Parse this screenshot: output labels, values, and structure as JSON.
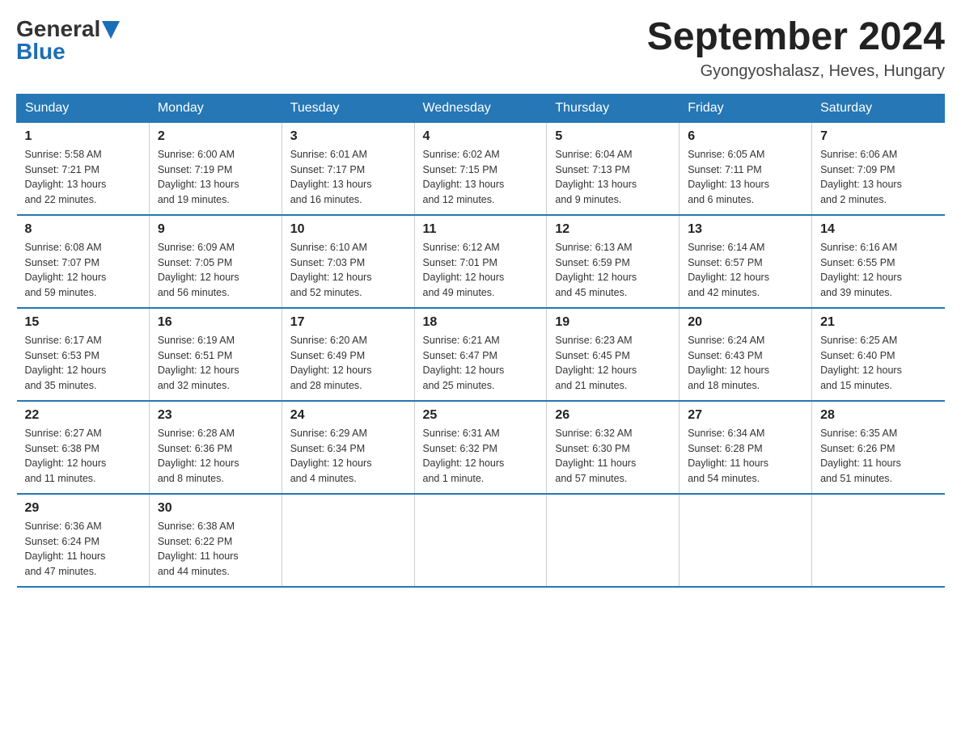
{
  "header": {
    "logo_general": "General",
    "logo_blue": "Blue",
    "title": "September 2024",
    "subtitle": "Gyongyoshalasz, Heves, Hungary"
  },
  "weekdays": [
    "Sunday",
    "Monday",
    "Tuesday",
    "Wednesday",
    "Thursday",
    "Friday",
    "Saturday"
  ],
  "weeks": [
    [
      {
        "num": "1",
        "info": "Sunrise: 5:58 AM\nSunset: 7:21 PM\nDaylight: 13 hours\nand 22 minutes."
      },
      {
        "num": "2",
        "info": "Sunrise: 6:00 AM\nSunset: 7:19 PM\nDaylight: 13 hours\nand 19 minutes."
      },
      {
        "num": "3",
        "info": "Sunrise: 6:01 AM\nSunset: 7:17 PM\nDaylight: 13 hours\nand 16 minutes."
      },
      {
        "num": "4",
        "info": "Sunrise: 6:02 AM\nSunset: 7:15 PM\nDaylight: 13 hours\nand 12 minutes."
      },
      {
        "num": "5",
        "info": "Sunrise: 6:04 AM\nSunset: 7:13 PM\nDaylight: 13 hours\nand 9 minutes."
      },
      {
        "num": "6",
        "info": "Sunrise: 6:05 AM\nSunset: 7:11 PM\nDaylight: 13 hours\nand 6 minutes."
      },
      {
        "num": "7",
        "info": "Sunrise: 6:06 AM\nSunset: 7:09 PM\nDaylight: 13 hours\nand 2 minutes."
      }
    ],
    [
      {
        "num": "8",
        "info": "Sunrise: 6:08 AM\nSunset: 7:07 PM\nDaylight: 12 hours\nand 59 minutes."
      },
      {
        "num": "9",
        "info": "Sunrise: 6:09 AM\nSunset: 7:05 PM\nDaylight: 12 hours\nand 56 minutes."
      },
      {
        "num": "10",
        "info": "Sunrise: 6:10 AM\nSunset: 7:03 PM\nDaylight: 12 hours\nand 52 minutes."
      },
      {
        "num": "11",
        "info": "Sunrise: 6:12 AM\nSunset: 7:01 PM\nDaylight: 12 hours\nand 49 minutes."
      },
      {
        "num": "12",
        "info": "Sunrise: 6:13 AM\nSunset: 6:59 PM\nDaylight: 12 hours\nand 45 minutes."
      },
      {
        "num": "13",
        "info": "Sunrise: 6:14 AM\nSunset: 6:57 PM\nDaylight: 12 hours\nand 42 minutes."
      },
      {
        "num": "14",
        "info": "Sunrise: 6:16 AM\nSunset: 6:55 PM\nDaylight: 12 hours\nand 39 minutes."
      }
    ],
    [
      {
        "num": "15",
        "info": "Sunrise: 6:17 AM\nSunset: 6:53 PM\nDaylight: 12 hours\nand 35 minutes."
      },
      {
        "num": "16",
        "info": "Sunrise: 6:19 AM\nSunset: 6:51 PM\nDaylight: 12 hours\nand 32 minutes."
      },
      {
        "num": "17",
        "info": "Sunrise: 6:20 AM\nSunset: 6:49 PM\nDaylight: 12 hours\nand 28 minutes."
      },
      {
        "num": "18",
        "info": "Sunrise: 6:21 AM\nSunset: 6:47 PM\nDaylight: 12 hours\nand 25 minutes."
      },
      {
        "num": "19",
        "info": "Sunrise: 6:23 AM\nSunset: 6:45 PM\nDaylight: 12 hours\nand 21 minutes."
      },
      {
        "num": "20",
        "info": "Sunrise: 6:24 AM\nSunset: 6:43 PM\nDaylight: 12 hours\nand 18 minutes."
      },
      {
        "num": "21",
        "info": "Sunrise: 6:25 AM\nSunset: 6:40 PM\nDaylight: 12 hours\nand 15 minutes."
      }
    ],
    [
      {
        "num": "22",
        "info": "Sunrise: 6:27 AM\nSunset: 6:38 PM\nDaylight: 12 hours\nand 11 minutes."
      },
      {
        "num": "23",
        "info": "Sunrise: 6:28 AM\nSunset: 6:36 PM\nDaylight: 12 hours\nand 8 minutes."
      },
      {
        "num": "24",
        "info": "Sunrise: 6:29 AM\nSunset: 6:34 PM\nDaylight: 12 hours\nand 4 minutes."
      },
      {
        "num": "25",
        "info": "Sunrise: 6:31 AM\nSunset: 6:32 PM\nDaylight: 12 hours\nand 1 minute."
      },
      {
        "num": "26",
        "info": "Sunrise: 6:32 AM\nSunset: 6:30 PM\nDaylight: 11 hours\nand 57 minutes."
      },
      {
        "num": "27",
        "info": "Sunrise: 6:34 AM\nSunset: 6:28 PM\nDaylight: 11 hours\nand 54 minutes."
      },
      {
        "num": "28",
        "info": "Sunrise: 6:35 AM\nSunset: 6:26 PM\nDaylight: 11 hours\nand 51 minutes."
      }
    ],
    [
      {
        "num": "29",
        "info": "Sunrise: 6:36 AM\nSunset: 6:24 PM\nDaylight: 11 hours\nand 47 minutes."
      },
      {
        "num": "30",
        "info": "Sunrise: 6:38 AM\nSunset: 6:22 PM\nDaylight: 11 hours\nand 44 minutes."
      },
      {
        "num": "",
        "info": ""
      },
      {
        "num": "",
        "info": ""
      },
      {
        "num": "",
        "info": ""
      },
      {
        "num": "",
        "info": ""
      },
      {
        "num": "",
        "info": ""
      }
    ]
  ]
}
